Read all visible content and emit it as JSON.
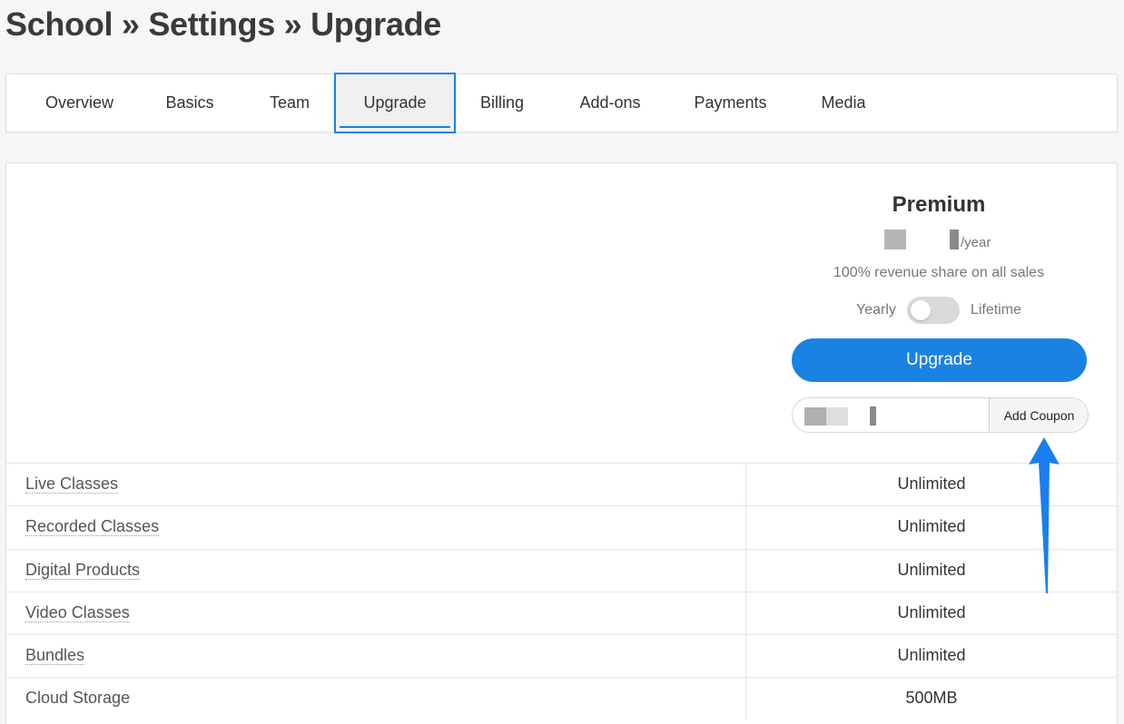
{
  "header": {
    "title": "School » Settings » Upgrade"
  },
  "tabs": [
    {
      "label": "Overview"
    },
    {
      "label": "Basics"
    },
    {
      "label": "Team"
    },
    {
      "label": "Upgrade",
      "active": true
    },
    {
      "label": "Billing"
    },
    {
      "label": "Add-ons"
    },
    {
      "label": "Payments"
    },
    {
      "label": "Media"
    }
  ],
  "plan": {
    "name": "Premium",
    "price_suffix": "/year",
    "revenue_share": "100% revenue share on all sales",
    "billing_toggle": {
      "left_label": "Yearly",
      "right_label": "Lifetime",
      "selected": "Yearly"
    },
    "upgrade_label": "Upgrade",
    "coupon": {
      "button_label": "Add Coupon"
    }
  },
  "features": [
    {
      "name": "Live Classes",
      "value": "Unlimited"
    },
    {
      "name": "Recorded Classes",
      "value": "Unlimited"
    },
    {
      "name": "Digital Products",
      "value": "Unlimited"
    },
    {
      "name": "Video Classes",
      "value": "Unlimited"
    },
    {
      "name": "Bundles",
      "value": "Unlimited"
    },
    {
      "name": "Cloud Storage",
      "value": "500MB"
    }
  ],
  "colors": {
    "accent": "#1a82e2",
    "annotation_arrow": "#1a7ff0",
    "background": "#f6f6f9"
  },
  "annotation": {
    "icon": "up-arrow-icon",
    "points_to": "Add Coupon"
  }
}
